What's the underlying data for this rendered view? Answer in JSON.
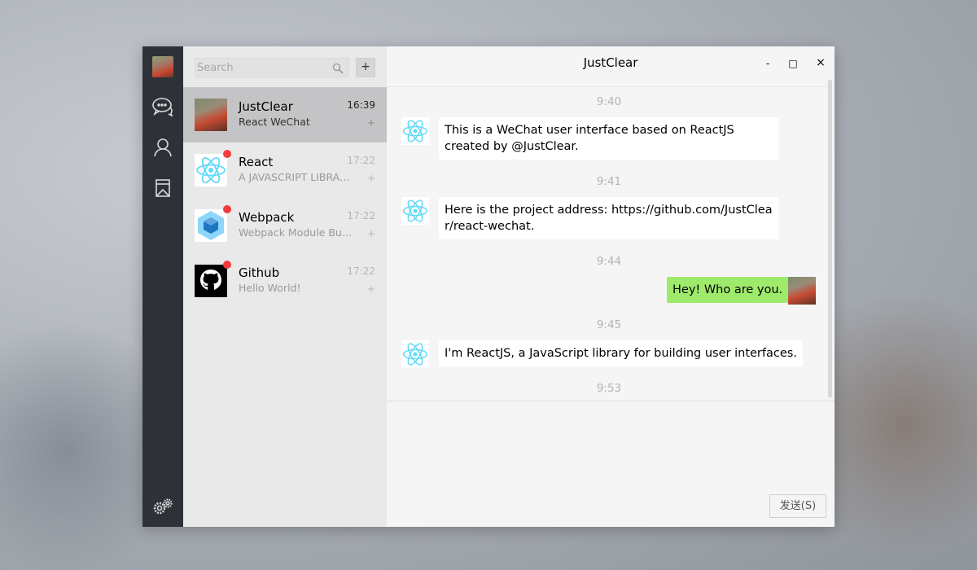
{
  "window": {
    "title": "JustClear",
    "minimize": "-",
    "maximize": "□",
    "close": "×"
  },
  "sidebar": {
    "icons": [
      "avatar",
      "chat-icon",
      "contacts-icon",
      "favorites-icon",
      "settings-icon"
    ]
  },
  "search": {
    "placeholder": "Search",
    "add_label": "+"
  },
  "sessions": [
    {
      "name": "JustClear",
      "message": "React WeChat",
      "time": "16:39",
      "plus": "+",
      "unread": false,
      "active": true
    },
    {
      "name": "React",
      "message": "A JAVASCRIPT LIBRARY FOR BUILDING USER INTERFACES",
      "time": "17:22",
      "plus": "+",
      "unread": true,
      "active": false
    },
    {
      "name": "Webpack",
      "message": "Webpack Module Bundler",
      "time": "17:22",
      "plus": "+",
      "unread": true,
      "active": false
    },
    {
      "name": "Github",
      "message": "Hello World!",
      "time": "17:22",
      "plus": "+",
      "unread": true,
      "active": false
    }
  ],
  "messages": [
    {
      "time": "9:40",
      "from": "other",
      "text": "This is a WeChat user interface based on ReactJS created by @JustClear."
    },
    {
      "time": "9:41",
      "from": "other",
      "text": "Here is the project address: https://github.com/JustClear/react-wechat."
    },
    {
      "time": "9:44",
      "from": "me",
      "text": "Hey! Who are you."
    },
    {
      "time": "9:45",
      "from": "other",
      "text": "I'm ReactJS, a JavaScript library for building user interfaces."
    },
    {
      "time": "9:53"
    }
  ],
  "composer": {
    "send_label": "发送(S)"
  },
  "colors": {
    "rail": "#2e3238",
    "list": "#e9e9e9",
    "active": "#c4c4c6",
    "chat": "#f5f5f5",
    "bubble_mine": "#9eea6a",
    "unread": "#f23c3c"
  }
}
